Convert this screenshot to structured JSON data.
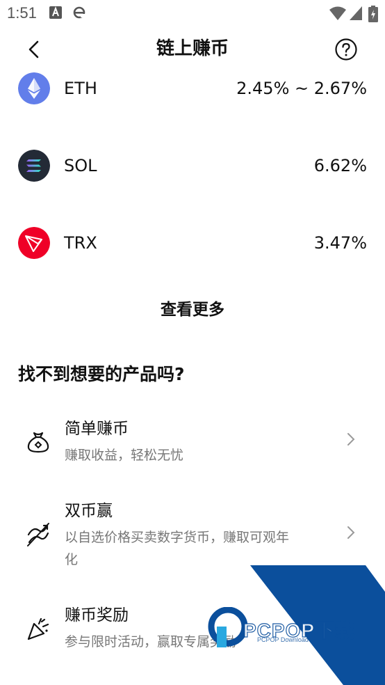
{
  "status_bar": {
    "time": "1:51"
  },
  "header": {
    "title": "链上赚币"
  },
  "coins": [
    {
      "symbol": "ETH",
      "rate": "2.45% ~ 2.67%"
    },
    {
      "symbol": "SOL",
      "rate": "6.62%"
    },
    {
      "symbol": "TRX",
      "rate": "3.47%"
    }
  ],
  "view_more_label": "查看更多",
  "section": {
    "title": "找不到想要的产品吗?",
    "products": [
      {
        "name": "简单赚币",
        "desc": "赚取收益，轻松无忧"
      },
      {
        "name": "双币赢",
        "desc_line1": "以自选价格买卖数字货币，赚取可观年",
        "desc_line2": "化"
      },
      {
        "name": "赚币奖励",
        "desc": "参与限时活动，赢取专属奖励"
      }
    ]
  },
  "watermark": {
    "brand": "PCPOP下载",
    "sub": "PCPOP Download"
  },
  "colors": {
    "eth": "#627EEA",
    "sol": "#232A36",
    "trx": "#EF0027",
    "watermark_blue": "#0B4F9C"
  }
}
